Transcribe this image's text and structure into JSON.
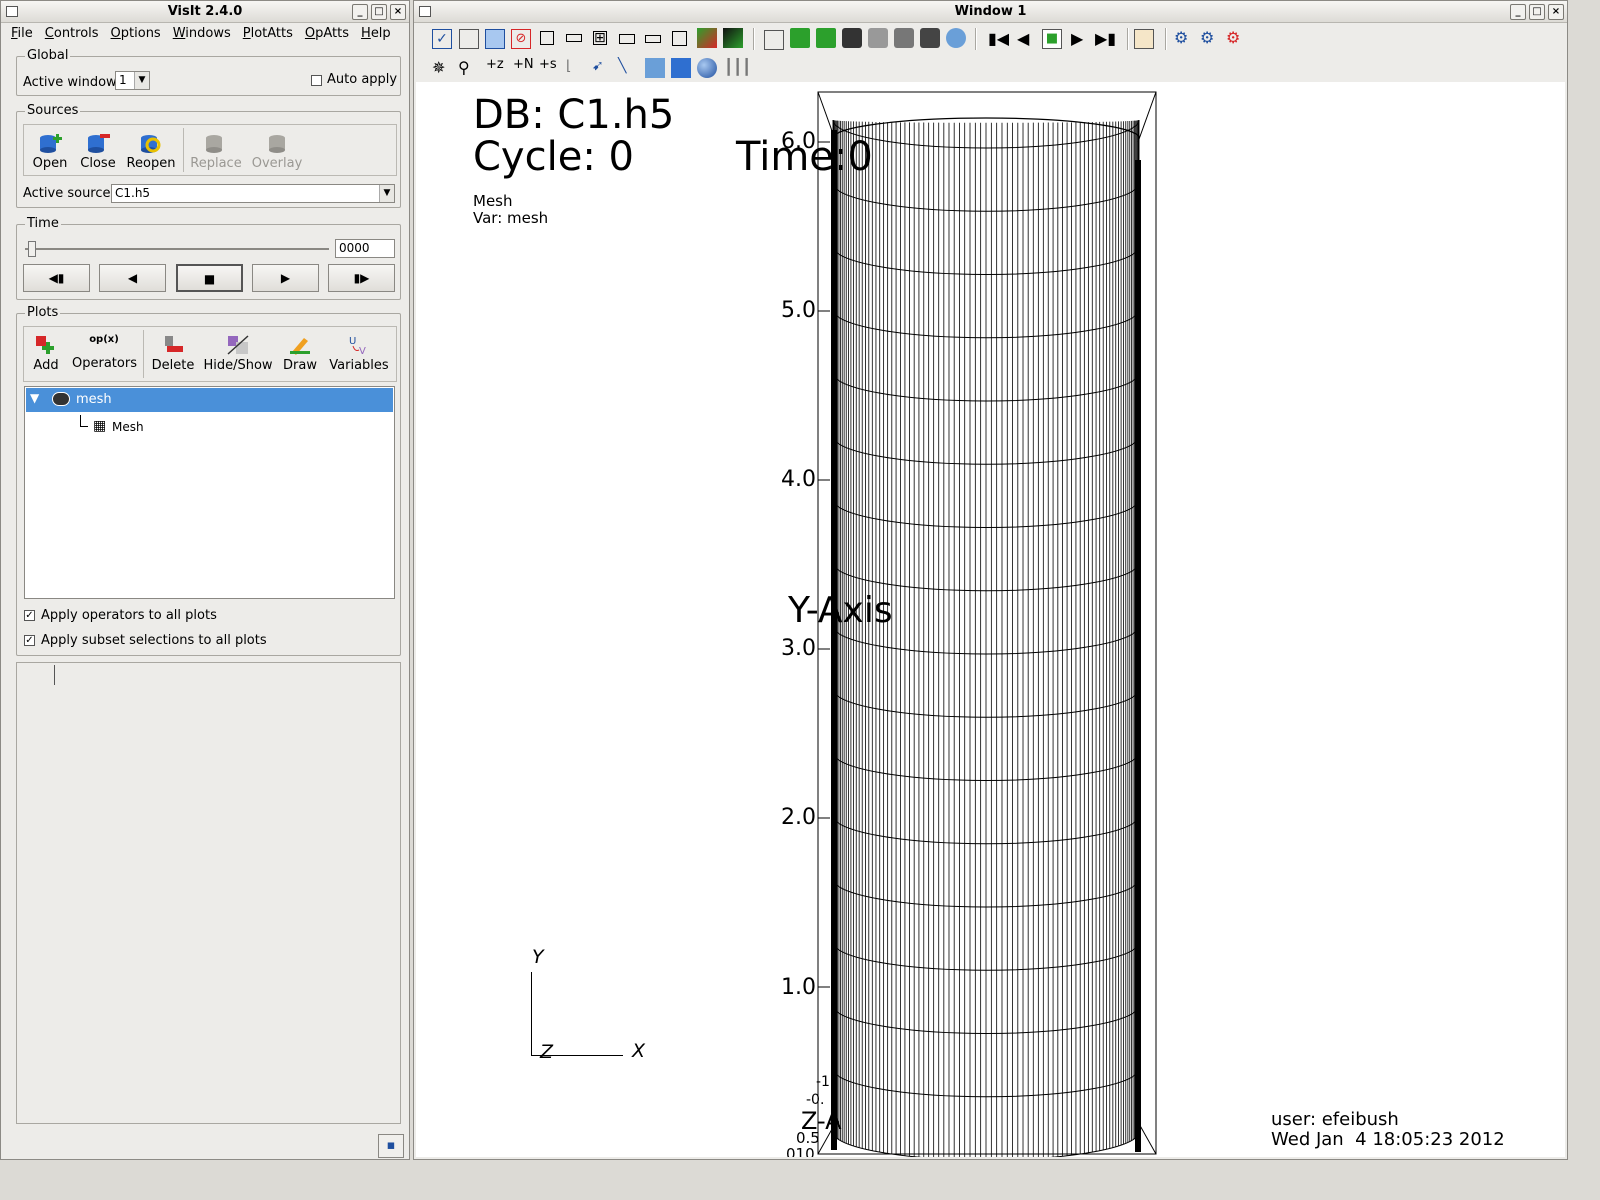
{
  "gui_window": {
    "title": "VisIt 2.4.0",
    "menus": [
      "File",
      "Controls",
      "Options",
      "Windows",
      "PlotAtts",
      "OpAtts",
      "Help"
    ],
    "global": {
      "title": "Global",
      "active_window_label": "Active window",
      "active_window_value": "1",
      "auto_apply_label": "Auto apply"
    },
    "sources": {
      "title": "Sources",
      "buttons": [
        "Open",
        "Close",
        "Reopen",
        "Replace",
        "Overlay"
      ],
      "active_source_label": "Active source",
      "active_source_value": "C1.h5"
    },
    "time": {
      "title": "Time",
      "value": "0000",
      "vcr": [
        "◀▮",
        "◀",
        "■",
        "▶",
        "▮▶"
      ]
    },
    "plots": {
      "title": "Plots",
      "buttons": [
        "Add",
        "Operators",
        "Delete",
        "Hide/Show",
        "Draw",
        "Variables"
      ],
      "op_icon_text": "op(x)",
      "tree_plot_name": "mesh",
      "tree_child_name": "Mesh",
      "apply_operators_label": "Apply operators to all plots",
      "apply_subset_label": "Apply subset selections to all plots"
    }
  },
  "viz_window": {
    "title": "Window 1",
    "db_line": "DB: C1.h5",
    "cycle_line": "Cycle: 0",
    "time_line": "Time:0",
    "legend_plot": "Mesh",
    "legend_var": "Var: mesh",
    "y_axis_title": "Y-Axis",
    "y_ticks": [
      "1.0",
      "2.0",
      "3.0",
      "4.0",
      "5.0",
      "6.0"
    ],
    "triad_labels": {
      "y": "Y",
      "z": "Z",
      "x": "X"
    },
    "user_line": "user: efeibush",
    "date_line": "Wed Jan  4 18:05:23 2012",
    "bottom_tick_fragments": [
      "-1",
      "-0.",
      "0.5",
      "010",
      "Z-A"
    ]
  },
  "colors": {
    "selection": "#4a90d9",
    "panel_bg": "#edece9",
    "mesh_line": "#000000"
  }
}
